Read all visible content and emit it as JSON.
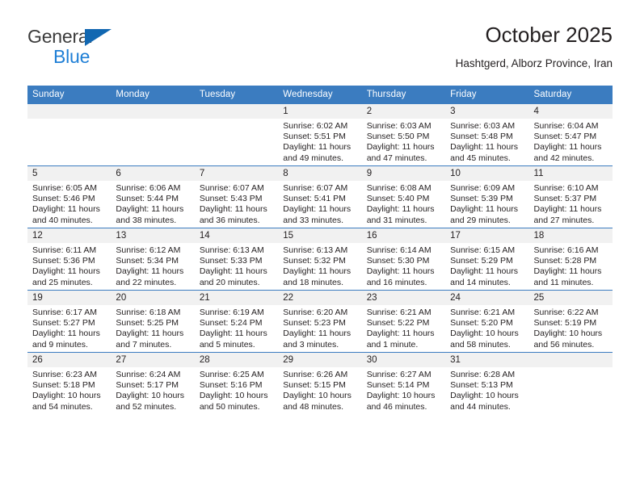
{
  "brand": {
    "name_top": "General",
    "name_bottom": "Blue",
    "triangle_color": "#1167b1",
    "bottom_color": "#1f7fd6"
  },
  "header": {
    "title": "October 2025",
    "subtitle": "Hashtgerd, Alborz Province, Iran"
  },
  "colors": {
    "header_row_bg": "#3b7cc0",
    "daynum_bg": "#f1f1f1",
    "text": "#231f20"
  },
  "weekdays": [
    "Sunday",
    "Monday",
    "Tuesday",
    "Wednesday",
    "Thursday",
    "Friday",
    "Saturday"
  ],
  "weeks": [
    [
      {
        "day": "",
        "sunrise": "",
        "sunset": "",
        "daylight_line1": "",
        "daylight_line2": ""
      },
      {
        "day": "",
        "sunrise": "",
        "sunset": "",
        "daylight_line1": "",
        "daylight_line2": ""
      },
      {
        "day": "",
        "sunrise": "",
        "sunset": "",
        "daylight_line1": "",
        "daylight_line2": ""
      },
      {
        "day": "1",
        "sunrise": "Sunrise: 6:02 AM",
        "sunset": "Sunset: 5:51 PM",
        "daylight_line1": "Daylight: 11 hours",
        "daylight_line2": "and 49 minutes."
      },
      {
        "day": "2",
        "sunrise": "Sunrise: 6:03 AM",
        "sunset": "Sunset: 5:50 PM",
        "daylight_line1": "Daylight: 11 hours",
        "daylight_line2": "and 47 minutes."
      },
      {
        "day": "3",
        "sunrise": "Sunrise: 6:03 AM",
        "sunset": "Sunset: 5:48 PM",
        "daylight_line1": "Daylight: 11 hours",
        "daylight_line2": "and 45 minutes."
      },
      {
        "day": "4",
        "sunrise": "Sunrise: 6:04 AM",
        "sunset": "Sunset: 5:47 PM",
        "daylight_line1": "Daylight: 11 hours",
        "daylight_line2": "and 42 minutes."
      }
    ],
    [
      {
        "day": "5",
        "sunrise": "Sunrise: 6:05 AM",
        "sunset": "Sunset: 5:46 PM",
        "daylight_line1": "Daylight: 11 hours",
        "daylight_line2": "and 40 minutes."
      },
      {
        "day": "6",
        "sunrise": "Sunrise: 6:06 AM",
        "sunset": "Sunset: 5:44 PM",
        "daylight_line1": "Daylight: 11 hours",
        "daylight_line2": "and 38 minutes."
      },
      {
        "day": "7",
        "sunrise": "Sunrise: 6:07 AM",
        "sunset": "Sunset: 5:43 PM",
        "daylight_line1": "Daylight: 11 hours",
        "daylight_line2": "and 36 minutes."
      },
      {
        "day": "8",
        "sunrise": "Sunrise: 6:07 AM",
        "sunset": "Sunset: 5:41 PM",
        "daylight_line1": "Daylight: 11 hours",
        "daylight_line2": "and 33 minutes."
      },
      {
        "day": "9",
        "sunrise": "Sunrise: 6:08 AM",
        "sunset": "Sunset: 5:40 PM",
        "daylight_line1": "Daylight: 11 hours",
        "daylight_line2": "and 31 minutes."
      },
      {
        "day": "10",
        "sunrise": "Sunrise: 6:09 AM",
        "sunset": "Sunset: 5:39 PM",
        "daylight_line1": "Daylight: 11 hours",
        "daylight_line2": "and 29 minutes."
      },
      {
        "day": "11",
        "sunrise": "Sunrise: 6:10 AM",
        "sunset": "Sunset: 5:37 PM",
        "daylight_line1": "Daylight: 11 hours",
        "daylight_line2": "and 27 minutes."
      }
    ],
    [
      {
        "day": "12",
        "sunrise": "Sunrise: 6:11 AM",
        "sunset": "Sunset: 5:36 PM",
        "daylight_line1": "Daylight: 11 hours",
        "daylight_line2": "and 25 minutes."
      },
      {
        "day": "13",
        "sunrise": "Sunrise: 6:12 AM",
        "sunset": "Sunset: 5:34 PM",
        "daylight_line1": "Daylight: 11 hours",
        "daylight_line2": "and 22 minutes."
      },
      {
        "day": "14",
        "sunrise": "Sunrise: 6:13 AM",
        "sunset": "Sunset: 5:33 PM",
        "daylight_line1": "Daylight: 11 hours",
        "daylight_line2": "and 20 minutes."
      },
      {
        "day": "15",
        "sunrise": "Sunrise: 6:13 AM",
        "sunset": "Sunset: 5:32 PM",
        "daylight_line1": "Daylight: 11 hours",
        "daylight_line2": "and 18 minutes."
      },
      {
        "day": "16",
        "sunrise": "Sunrise: 6:14 AM",
        "sunset": "Sunset: 5:30 PM",
        "daylight_line1": "Daylight: 11 hours",
        "daylight_line2": "and 16 minutes."
      },
      {
        "day": "17",
        "sunrise": "Sunrise: 6:15 AM",
        "sunset": "Sunset: 5:29 PM",
        "daylight_line1": "Daylight: 11 hours",
        "daylight_line2": "and 14 minutes."
      },
      {
        "day": "18",
        "sunrise": "Sunrise: 6:16 AM",
        "sunset": "Sunset: 5:28 PM",
        "daylight_line1": "Daylight: 11 hours",
        "daylight_line2": "and 11 minutes."
      }
    ],
    [
      {
        "day": "19",
        "sunrise": "Sunrise: 6:17 AM",
        "sunset": "Sunset: 5:27 PM",
        "daylight_line1": "Daylight: 11 hours",
        "daylight_line2": "and 9 minutes."
      },
      {
        "day": "20",
        "sunrise": "Sunrise: 6:18 AM",
        "sunset": "Sunset: 5:25 PM",
        "daylight_line1": "Daylight: 11 hours",
        "daylight_line2": "and 7 minutes."
      },
      {
        "day": "21",
        "sunrise": "Sunrise: 6:19 AM",
        "sunset": "Sunset: 5:24 PM",
        "daylight_line1": "Daylight: 11 hours",
        "daylight_line2": "and 5 minutes."
      },
      {
        "day": "22",
        "sunrise": "Sunrise: 6:20 AM",
        "sunset": "Sunset: 5:23 PM",
        "daylight_line1": "Daylight: 11 hours",
        "daylight_line2": "and 3 minutes."
      },
      {
        "day": "23",
        "sunrise": "Sunrise: 6:21 AM",
        "sunset": "Sunset: 5:22 PM",
        "daylight_line1": "Daylight: 11 hours",
        "daylight_line2": "and 1 minute."
      },
      {
        "day": "24",
        "sunrise": "Sunrise: 6:21 AM",
        "sunset": "Sunset: 5:20 PM",
        "daylight_line1": "Daylight: 10 hours",
        "daylight_line2": "and 58 minutes."
      },
      {
        "day": "25",
        "sunrise": "Sunrise: 6:22 AM",
        "sunset": "Sunset: 5:19 PM",
        "daylight_line1": "Daylight: 10 hours",
        "daylight_line2": "and 56 minutes."
      }
    ],
    [
      {
        "day": "26",
        "sunrise": "Sunrise: 6:23 AM",
        "sunset": "Sunset: 5:18 PM",
        "daylight_line1": "Daylight: 10 hours",
        "daylight_line2": "and 54 minutes."
      },
      {
        "day": "27",
        "sunrise": "Sunrise: 6:24 AM",
        "sunset": "Sunset: 5:17 PM",
        "daylight_line1": "Daylight: 10 hours",
        "daylight_line2": "and 52 minutes."
      },
      {
        "day": "28",
        "sunrise": "Sunrise: 6:25 AM",
        "sunset": "Sunset: 5:16 PM",
        "daylight_line1": "Daylight: 10 hours",
        "daylight_line2": "and 50 minutes."
      },
      {
        "day": "29",
        "sunrise": "Sunrise: 6:26 AM",
        "sunset": "Sunset: 5:15 PM",
        "daylight_line1": "Daylight: 10 hours",
        "daylight_line2": "and 48 minutes."
      },
      {
        "day": "30",
        "sunrise": "Sunrise: 6:27 AM",
        "sunset": "Sunset: 5:14 PM",
        "daylight_line1": "Daylight: 10 hours",
        "daylight_line2": "and 46 minutes."
      },
      {
        "day": "31",
        "sunrise": "Sunrise: 6:28 AM",
        "sunset": "Sunset: 5:13 PM",
        "daylight_line1": "Daylight: 10 hours",
        "daylight_line2": "and 44 minutes."
      },
      {
        "day": "",
        "sunrise": "",
        "sunset": "",
        "daylight_line1": "",
        "daylight_line2": ""
      }
    ]
  ]
}
